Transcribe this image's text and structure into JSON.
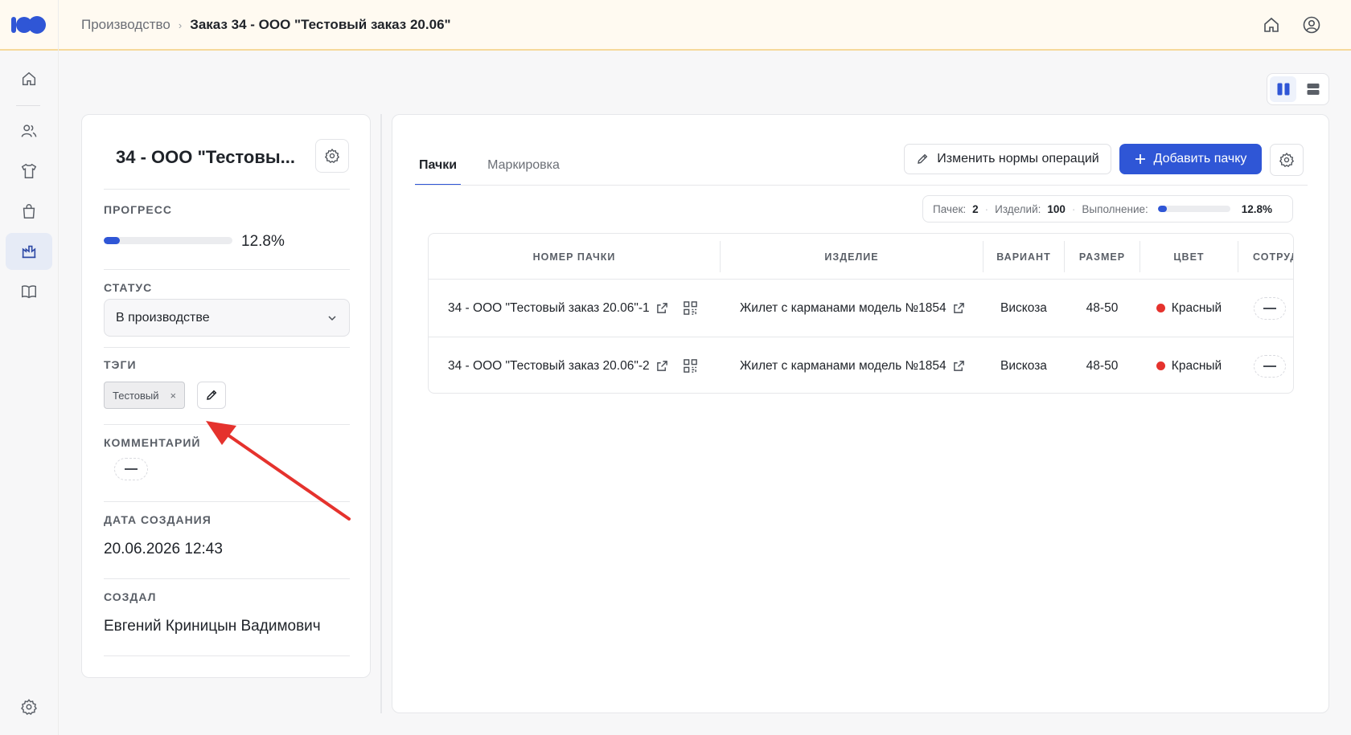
{
  "breadcrumb": {
    "parent": "Производство",
    "separator": "›",
    "current": "Заказ 34 - ООО \"Тестовый заказ 20.06\""
  },
  "topbar": {
    "icons": [
      "home-icon",
      "user-circle-icon"
    ]
  },
  "sidebar": {
    "items": [
      {
        "icon": "home-icon",
        "active": false
      },
      {
        "icon": "users-icon",
        "active": false
      },
      {
        "icon": "shirt-icon",
        "active": false
      },
      {
        "icon": "bag-icon",
        "active": false
      },
      {
        "icon": "production-icon",
        "active": true
      },
      {
        "icon": "book-icon",
        "active": false
      }
    ],
    "bottom_icon": "gear-icon"
  },
  "order": {
    "title": "34 - ООО \"Тестовы...",
    "progress_label": "ПРОГРЕСС",
    "progress_value": 12.8,
    "progress_text": "12.8%",
    "status_label": "СТАТУС",
    "status_value": "В производстве",
    "tags_label": "ТЭГИ",
    "tags": [
      "Тестовый"
    ],
    "tag_remove": "×",
    "comment_label": "КОММЕНТАРИЙ",
    "created_date_label": "ДАТА СОЗДАНИЯ",
    "created_date": "20.06.2026 12:43",
    "created_by_label": "СОЗДАЛ",
    "created_by": "Евгений Криницын Вадимович"
  },
  "tabs": [
    {
      "label": "Пачки",
      "active": true
    },
    {
      "label": "Маркировка",
      "active": false
    }
  ],
  "actions": {
    "edit_norms": "Изменить нормы операций",
    "add_batch": "Добавить пачку"
  },
  "stats": {
    "batches_label": "Пачек:",
    "batches_value": "2",
    "items_label": "Изделий:",
    "items_value": "100",
    "completion_label": "Выполнение:",
    "completion_value": 12.8,
    "completion_text": "12.8%"
  },
  "table": {
    "columns": [
      "НОМЕР ПАЧКИ",
      "ИЗДЕЛИЕ",
      "ВАРИАНТ",
      "РАЗМЕР",
      "ЦВЕТ",
      "СОТРУД"
    ],
    "rows": [
      {
        "batch": "34 - ООО \"Тестовый заказ 20.06\"-1",
        "product": "Жилет с карманами модель №1854",
        "variant": "Вискоза",
        "size": "48-50",
        "color": "Красный",
        "color_hex": "#e5322d"
      },
      {
        "batch": "34 - ООО \"Тестовый заказ 20.06\"-2",
        "product": "Жилет с карманами модель №1854",
        "variant": "Вискоза",
        "size": "48-50",
        "color": "Красный",
        "color_hex": "#e5322d"
      }
    ]
  },
  "colors": {
    "accent": "#2f56d6",
    "annotation_arrow": "#e5322d",
    "topbar_bg": "#fffaf1",
    "topbar_border": "#f6d99a"
  }
}
